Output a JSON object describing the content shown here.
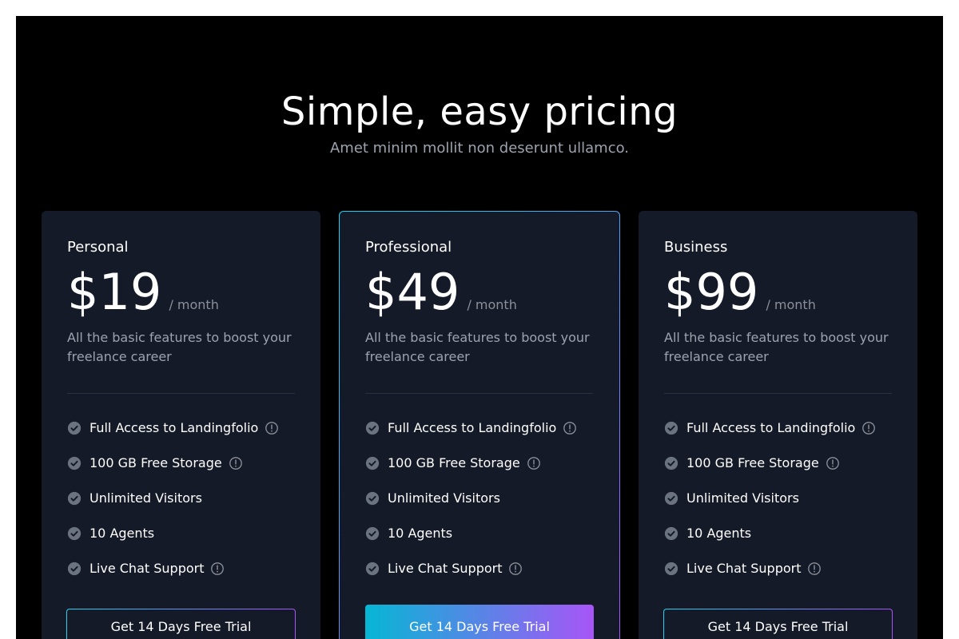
{
  "header": {
    "title": "Simple, easy pricing",
    "subtitle": "Amet minim mollit non deserunt ullamco."
  },
  "colors": {
    "background": "#000000",
    "card": "#151a28",
    "accent_start": "#22d3ee",
    "accent_end": "#a855f7",
    "muted_text": "#9ca3af",
    "check_icon": "#6b7280"
  },
  "icons": {
    "check": "check-circle-icon",
    "info": "info-circle-icon"
  },
  "plans": [
    {
      "name": "Personal",
      "price": "$19",
      "period": "/ month",
      "description": "All the basic features to boost your freelance career",
      "features": [
        {
          "label": "Full Access to Landingfolio",
          "info": true
        },
        {
          "label": "100 GB Free Storage",
          "info": true
        },
        {
          "label": "Unlimited Visitors",
          "info": false
        },
        {
          "label": "10 Agents",
          "info": false
        },
        {
          "label": "Live Chat Support",
          "info": true
        }
      ],
      "cta": "Get 14 Days Free Trial",
      "highlighted": false
    },
    {
      "name": "Professional",
      "price": "$49",
      "period": "/ month",
      "description": "All the basic features to boost your freelance career",
      "features": [
        {
          "label": "Full Access to Landingfolio",
          "info": true
        },
        {
          "label": "100 GB Free Storage",
          "info": true
        },
        {
          "label": "Unlimited Visitors",
          "info": false
        },
        {
          "label": "10 Agents",
          "info": false
        },
        {
          "label": "Live Chat Support",
          "info": true
        }
      ],
      "cta": "Get 14 Days Free Trial",
      "highlighted": true
    },
    {
      "name": "Business",
      "price": "$99",
      "period": "/ month",
      "description": "All the basic features to boost your freelance career",
      "features": [
        {
          "label": "Full Access to Landingfolio",
          "info": true
        },
        {
          "label": "100 GB Free Storage",
          "info": true
        },
        {
          "label": "Unlimited Visitors",
          "info": false
        },
        {
          "label": "10 Agents",
          "info": false
        },
        {
          "label": "Live Chat Support",
          "info": true
        }
      ],
      "cta": "Get 14 Days Free Trial",
      "highlighted": false
    }
  ]
}
